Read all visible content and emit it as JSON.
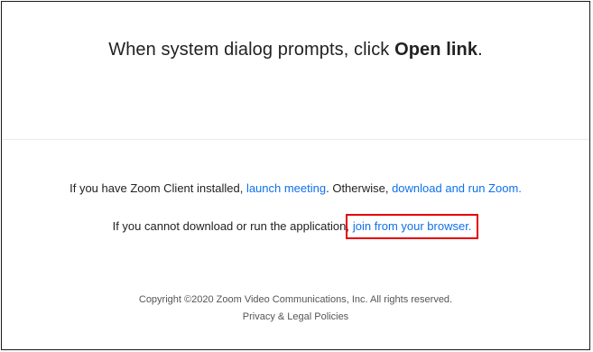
{
  "prompt": {
    "prefix": "When system dialog prompts, click ",
    "bold": "Open link",
    "suffix": "."
  },
  "install_line": {
    "text1": "If you have Zoom Client installed, ",
    "launch_link": "launch meeting",
    "text2": ". Otherwise, ",
    "download_link": "download and run Zoom."
  },
  "browser_line": {
    "text1": "If you cannot download or run the application,",
    "browser_link": "join from your browser."
  },
  "footer": {
    "copyright": "Copyright ©2020 Zoom Video Communications, Inc. All rights reserved.",
    "privacy": "Privacy & Legal Policies"
  },
  "colors": {
    "link": "#0e71eb",
    "highlight_border": "#e60000",
    "text": "#222222"
  }
}
